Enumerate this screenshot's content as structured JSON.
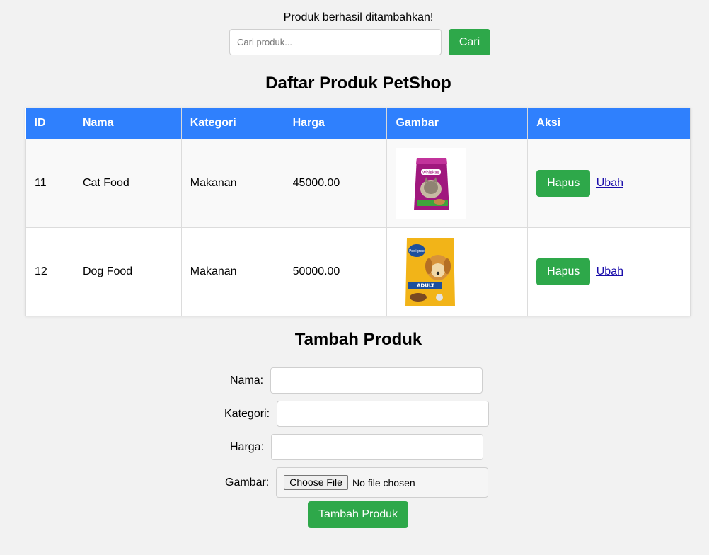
{
  "message": "Produk berhasil ditambahkan!",
  "search": {
    "placeholder": "Cari produk...",
    "button_label": "Cari"
  },
  "list_title": "Daftar Produk PetShop",
  "table": {
    "headers": [
      "ID",
      "Nama",
      "Kategori",
      "Harga",
      "Gambar",
      "Aksi"
    ],
    "rows": [
      {
        "id": "11",
        "nama": "Cat Food",
        "kategori": "Makanan",
        "harga": "45000.00",
        "image": "whiskas-cat-food-bag",
        "hapus": "Hapus",
        "ubah": "Ubah"
      },
      {
        "id": "12",
        "nama": "Dog Food",
        "kategori": "Makanan",
        "harga": "50000.00",
        "image": "pedigree-adult-dog-food-bag",
        "hapus": "Hapus",
        "ubah": "Ubah"
      }
    ]
  },
  "add_form": {
    "title": "Tambah Produk",
    "nama_label": "Nama:",
    "kategori_label": "Kategori:",
    "harga_label": "Harga:",
    "gambar_label": "Gambar:",
    "file_button": "Choose File",
    "file_status": "No file chosen",
    "submit_label": "Tambah Produk"
  },
  "colors": {
    "background": "#f2f2f2",
    "header_blue": "#2f80fd",
    "button_green": "#2ea84a",
    "link": "#1a0dab"
  }
}
